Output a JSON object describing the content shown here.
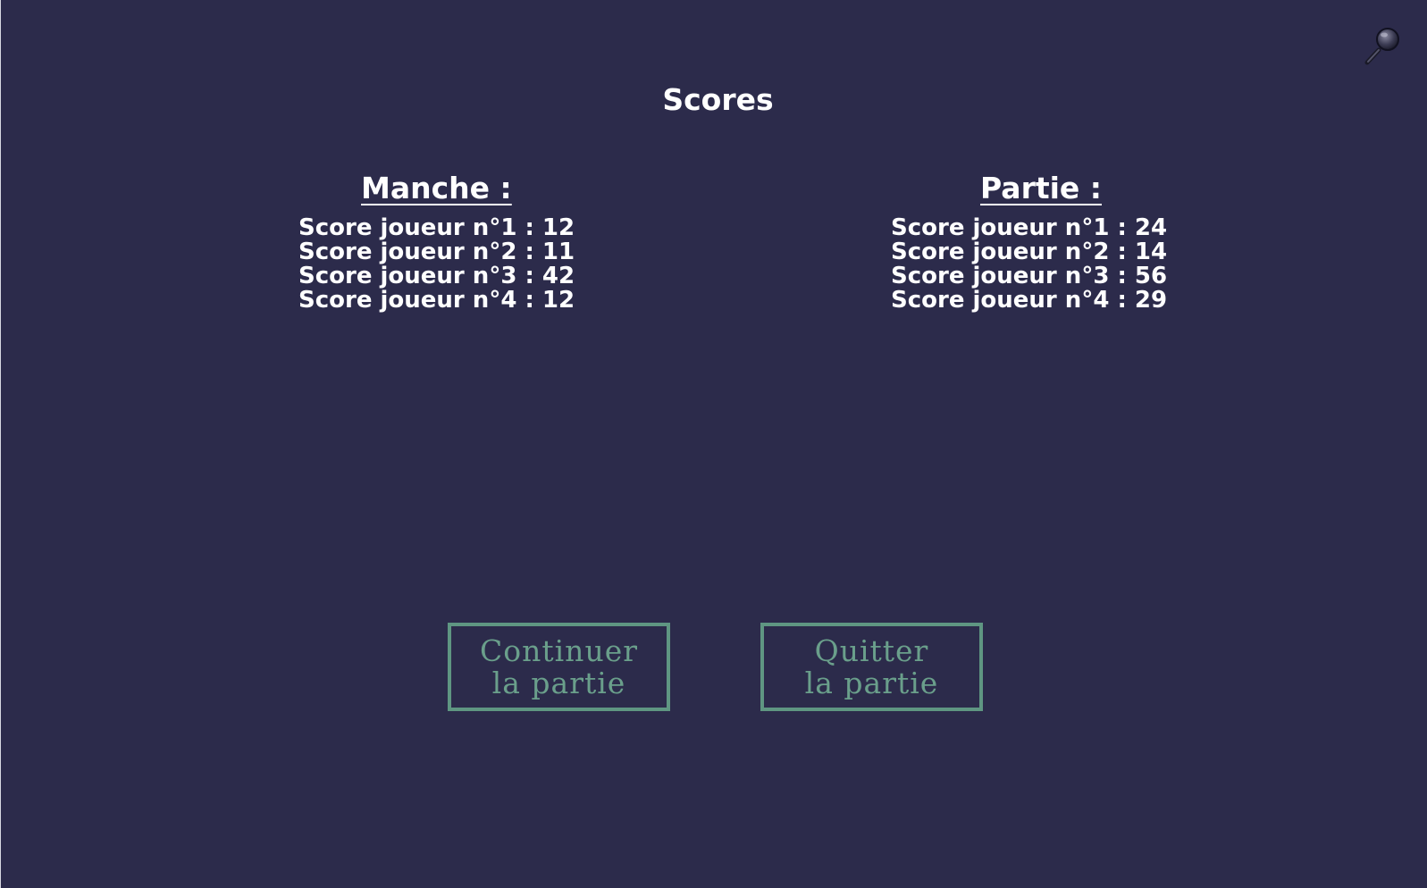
{
  "screen": {
    "title": "Scores"
  },
  "manche": {
    "heading": "Manche :",
    "scores": [
      "Score joueur n°1 : 12",
      "Score joueur n°2 : 11",
      "Score joueur n°3 : 42",
      "Score joueur n°4 : 12"
    ]
  },
  "partie": {
    "heading": "Partie :",
    "scores": [
      "Score joueur n°1 : 24",
      "Score joueur n°2 : 14",
      "Score joueur n°3 : 56",
      "Score joueur n°4 : 29"
    ]
  },
  "buttons": {
    "continue": {
      "line1": "Continuer",
      "line2": "la partie"
    },
    "quit": {
      "line1": "Quitter",
      "line2": "la partie"
    }
  },
  "icons": {
    "zoom": "magnifier-icon"
  },
  "colors": {
    "background": "#2c2b4b",
    "text": "#ffffff",
    "button_accent": "#5f9682"
  }
}
